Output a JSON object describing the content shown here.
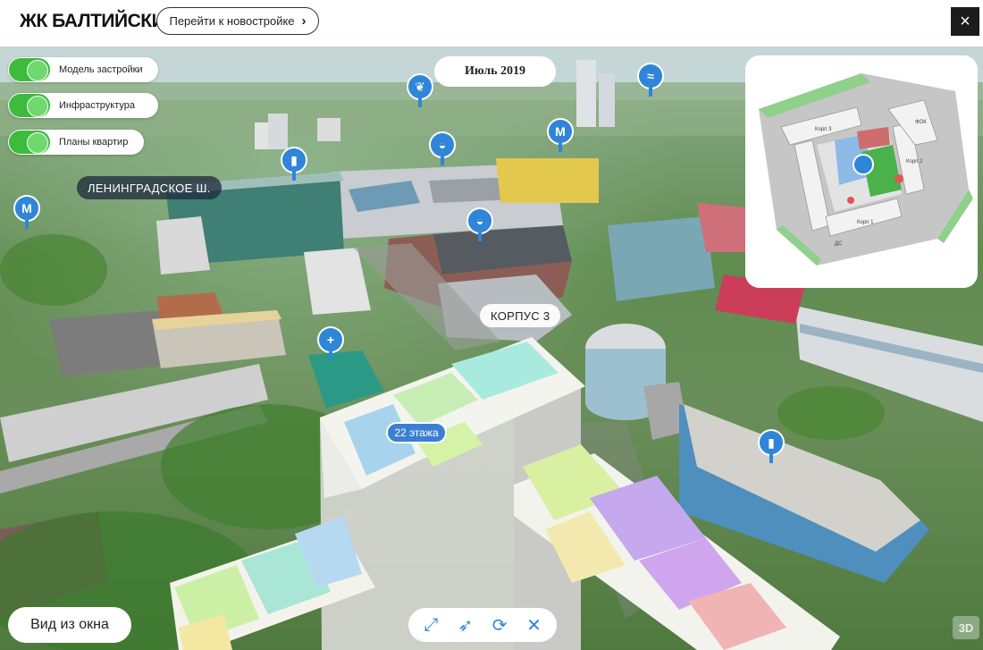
{
  "header": {
    "logo": "ЖК БАЛТИЙСКИЙ",
    "goto_label": "Перейти к новостройке",
    "goto_chevron": "›",
    "close_icon": "×"
  },
  "toggles": [
    {
      "label": "Модель застройки",
      "on": true
    },
    {
      "label": "Инфраструктура",
      "on": true
    },
    {
      "label": "Планы квартир",
      "on": true
    }
  ],
  "date": "Июль 2019",
  "labels": {
    "street": "ЛЕНИНГРАДСКОЕ Ш.",
    "building": "КОРПУС 3",
    "floors": "22 этажа"
  },
  "pins": {
    "metro": "M",
    "plus": "+"
  },
  "minimap": {
    "korp1": "Корп 1",
    "korp2": "Корп 2",
    "korp3": "Корп 3",
    "fok": "ФОК",
    "ds": "ДС"
  },
  "bottom": {
    "window_view": "Вид из окна",
    "badge": "3D"
  },
  "toolbar": {
    "fullscreen_icon": "⤢",
    "rotate_icon": "⟳",
    "close_icon": "✕"
  }
}
